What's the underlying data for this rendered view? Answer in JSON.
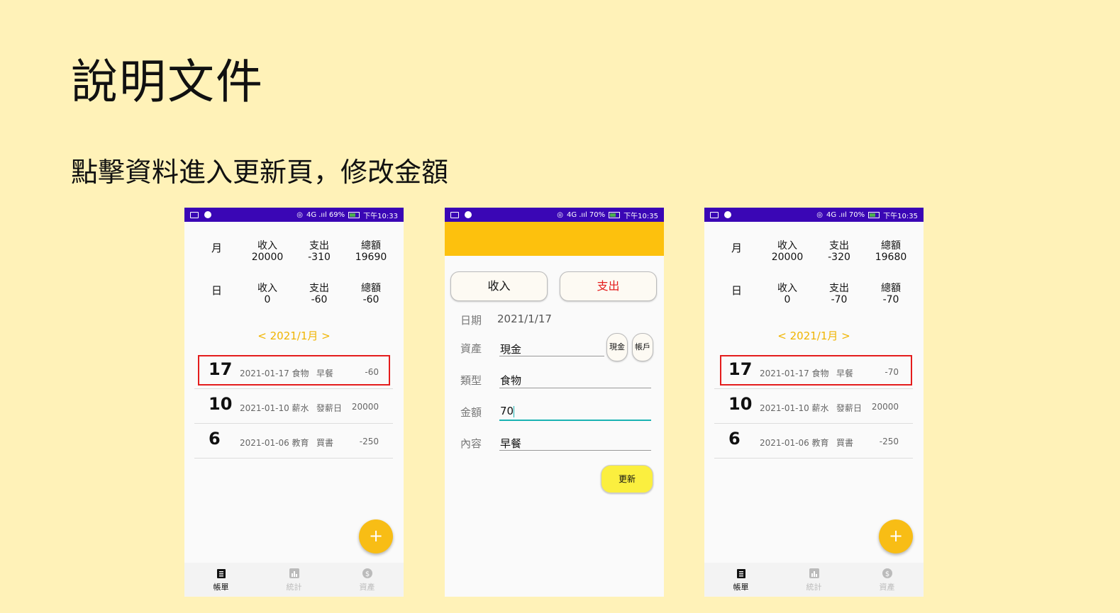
{
  "slide": {
    "title": "說明文件",
    "subtitle": "點擊資料進入更新頁，修改金額"
  },
  "phone1": {
    "status": {
      "left": "",
      "right_signal": "4G .ııl 69%",
      "time": "下午10:33"
    },
    "month_row": {
      "label": "月",
      "income_label": "收入",
      "income": "20000",
      "expense_label": "支出",
      "expense": "-310",
      "total_label": "總額",
      "total": "19690"
    },
    "day_row": {
      "label": "日",
      "income_label": "收入",
      "income": "0",
      "expense_label": "支出",
      "expense": "-60",
      "total_label": "總額",
      "total": "-60"
    },
    "month_nav": "< 2021/1月 >",
    "entries": [
      {
        "day": "17",
        "info": "2021-01-17 食物",
        "note": "早餐",
        "amount": "-60"
      },
      {
        "day": "10",
        "info": "2021-01-10 薪水",
        "note": "發薪日",
        "amount": "20000"
      },
      {
        "day": "6",
        "info": "2021-01-06 教育",
        "note": "買書",
        "amount": "-250"
      }
    ],
    "fab": "+",
    "nav": [
      {
        "label": "帳單"
      },
      {
        "label": "統計"
      },
      {
        "label": "資產"
      }
    ]
  },
  "phone2": {
    "status": {
      "right_signal": "4G .ııl 70%",
      "time": "下午10:35"
    },
    "income_btn": "收入",
    "expense_btn": "支出",
    "date_label": "日期",
    "date_value": "2021/1/17",
    "asset_label": "資產",
    "asset_value": "現金",
    "cash_btn": "現金",
    "account_btn": "帳戶",
    "type_label": "類型",
    "type_value": "食物",
    "amount_label": "金額",
    "amount_value": "70",
    "content_label": "內容",
    "content_value": "早餐",
    "update_btn": "更新"
  },
  "phone3": {
    "status": {
      "right_signal": "4G .ııl 70%",
      "time": "下午10:35"
    },
    "month_row": {
      "label": "月",
      "income_label": "收入",
      "income": "20000",
      "expense_label": "支出",
      "expense": "-320",
      "total_label": "總額",
      "total": "19680"
    },
    "day_row": {
      "label": "日",
      "income_label": "收入",
      "income": "0",
      "expense_label": "支出",
      "expense": "-70",
      "total_label": "總額",
      "total": "-70"
    },
    "month_nav": "< 2021/1月 >",
    "entries": [
      {
        "day": "17",
        "info": "2021-01-17 食物",
        "note": "早餐",
        "amount": "-70"
      },
      {
        "day": "10",
        "info": "2021-01-10 薪水",
        "note": "發薪日",
        "amount": "20000"
      },
      {
        "day": "6",
        "info": "2021-01-06 教育",
        "note": "買書",
        "amount": "-250"
      }
    ],
    "fab": "+",
    "nav": [
      {
        "label": "帳單"
      },
      {
        "label": "統計"
      },
      {
        "label": "資產"
      }
    ]
  },
  "colors": {
    "status_bar": "#3a06b5",
    "accent": "#fdc10d",
    "highlight": "#e41c1c",
    "expense": "#e41c1c"
  }
}
